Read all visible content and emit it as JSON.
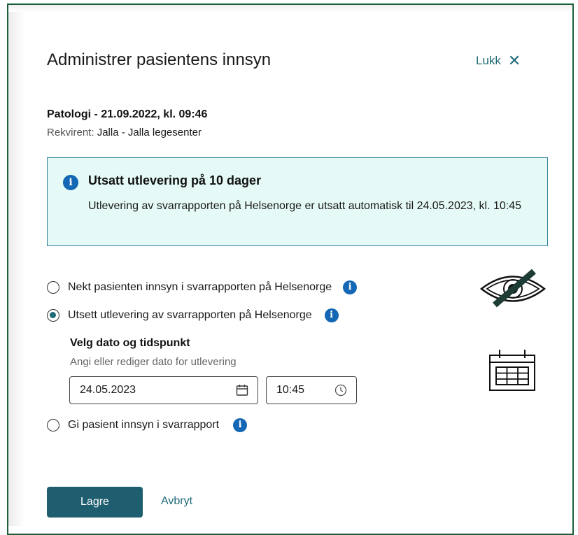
{
  "dialog": {
    "title": "Administrer pasientens innsyn",
    "close_label": "Lukk"
  },
  "report": {
    "heading": "Patologi - 21.09.2022, kl. 09:46",
    "rekvirent_label": "Rekvirent:",
    "rekvirent_value": "Jalla - Jalla legesenter"
  },
  "alert": {
    "title": "Utsatt utlevering på 10 dager",
    "text": "Utlevering av svarrapporten på Helsenorge er utsatt automatisk til 24.05.2023, kl. 10:45"
  },
  "options": [
    {
      "label": "Nekt pasienten innsyn i svarrapporten på Helsenorge",
      "selected": false
    },
    {
      "label": "Utsett utlevering av svarrapporten på Helsenorge",
      "selected": true
    },
    {
      "label": "Gi pasient innsyn i svarrapport",
      "selected": false
    }
  ],
  "datetime": {
    "title": "Velg dato og tidspunkt",
    "help": "Angi eller rediger dato for utlevering",
    "date_value": "24.05.2023",
    "time_value": "10:45"
  },
  "actions": {
    "save_label": "Lagre",
    "cancel_label": "Avbryt"
  },
  "colors": {
    "frame": "#1b5e3a",
    "accent": "#1f6a78",
    "primary_button": "#1f5e6f",
    "info": "#1467b4",
    "alert_bg": "#e5faf6"
  }
}
